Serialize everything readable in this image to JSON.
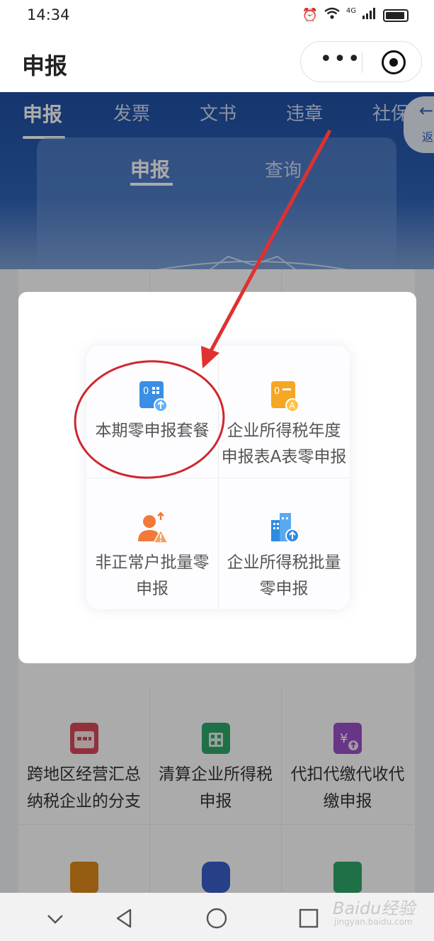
{
  "status_bar": {
    "time": "14:34",
    "network": "4G"
  },
  "header": {
    "title": "申报"
  },
  "top_tabs": [
    "申报",
    "发票",
    "文书",
    "违章",
    "社保"
  ],
  "back_button": {
    "label": "返"
  },
  "sub_tabs": {
    "active": "申报",
    "other": "查询"
  },
  "modal": {
    "items": [
      {
        "label": "本期零申报套餐",
        "icon": "zero-declaration-icon",
        "color": "#3a8ee6"
      },
      {
        "label": "企业所得税年度申报表A表零申报",
        "icon": "annual-tax-a-icon",
        "color": "#f5a623"
      },
      {
        "label": "非正常户批量零申报",
        "icon": "abnormal-user-icon",
        "color": "#f07a3a"
      },
      {
        "label": "企业所得税批量零申报",
        "icon": "batch-enterprise-icon",
        "color": "#2f8be0"
      }
    ]
  },
  "background_grid": {
    "items": [
      {
        "label": "跨地区经营汇总纳税企业的分支机构",
        "icon": "calendar-icon",
        "color": "#d94a5a"
      },
      {
        "label": "清算企业所得税申报",
        "icon": "calculator-doc-icon",
        "color": "#2fa86a"
      },
      {
        "label": "代扣代缴代收代缴申报",
        "icon": "yuan-doc-icon",
        "color": "#9b4fc9"
      }
    ],
    "bottom_icons": [
      {
        "icon": "chart-doc-icon",
        "color": "#e08a1c"
      },
      {
        "icon": "car-icon",
        "color": "#3b5fc9"
      },
      {
        "icon": "list-doc-icon",
        "color": "#2fa86a"
      }
    ]
  },
  "annotation": {
    "circle_color": "#d0262e",
    "arrow_color": "#e03030"
  },
  "nav_bar": {
    "items": [
      "chevron-down-icon",
      "back-triangle-icon",
      "home-circle-icon",
      "recents-square-icon"
    ]
  },
  "watermark": {
    "brand": "Baidu经验",
    "url": "jingyan.baidu.com"
  }
}
